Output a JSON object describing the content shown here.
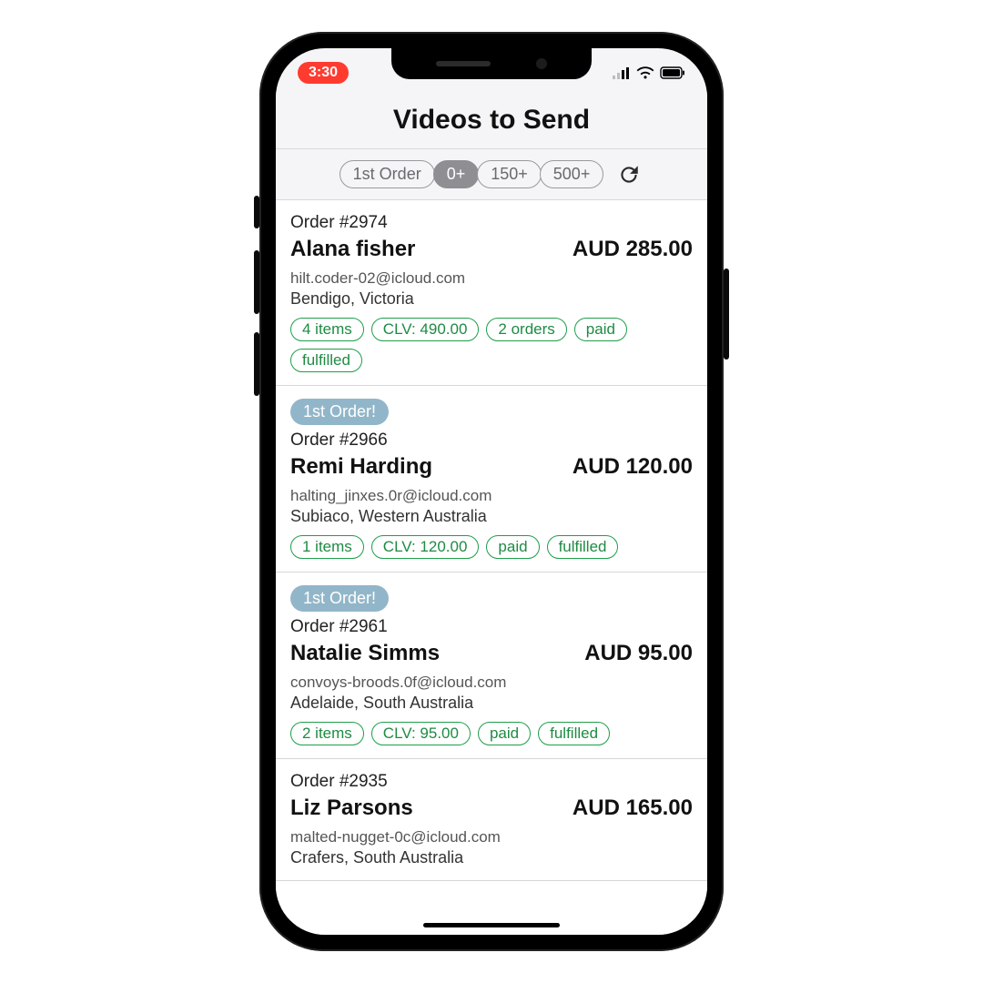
{
  "status": {
    "time": "3:30"
  },
  "header": {
    "title": "Videos to Send"
  },
  "filters": {
    "items": [
      {
        "label": "1st Order",
        "selected": false
      },
      {
        "label": "0+",
        "selected": true
      },
      {
        "label": "150+",
        "selected": false
      },
      {
        "label": "500+",
        "selected": false
      }
    ]
  },
  "orders": [
    {
      "first_order": false,
      "order_no": "Order #2974",
      "name": "Alana fisher",
      "price": "AUD 285.00",
      "email": "hilt.coder-02@icloud.com",
      "location": "Bendigo, Victoria",
      "tags": [
        "4 items",
        "CLV: 490.00",
        "2 orders",
        "paid",
        "fulfilled"
      ]
    },
    {
      "first_order": true,
      "first_label": "1st Order!",
      "order_no": "Order #2966",
      "name": "Remi Harding",
      "price": "AUD 120.00",
      "email": "halting_jinxes.0r@icloud.com",
      "location": "Subiaco, Western Australia",
      "tags": [
        "1 items",
        "CLV: 120.00",
        "paid",
        "fulfilled"
      ]
    },
    {
      "first_order": true,
      "first_label": "1st Order!",
      "order_no": "Order #2961",
      "name": "Natalie Simms",
      "price": "AUD 95.00",
      "email": "convoys-broods.0f@icloud.com",
      "location": "Adelaide, South Australia",
      "tags": [
        "2 items",
        "CLV: 95.00",
        "paid",
        "fulfilled"
      ]
    },
    {
      "first_order": false,
      "order_no": "Order #2935",
      "name": "Liz Parsons",
      "price": "AUD 165.00",
      "email": "malted-nugget-0c@icloud.com",
      "location": "Crafers, South Australia",
      "tags": []
    }
  ]
}
